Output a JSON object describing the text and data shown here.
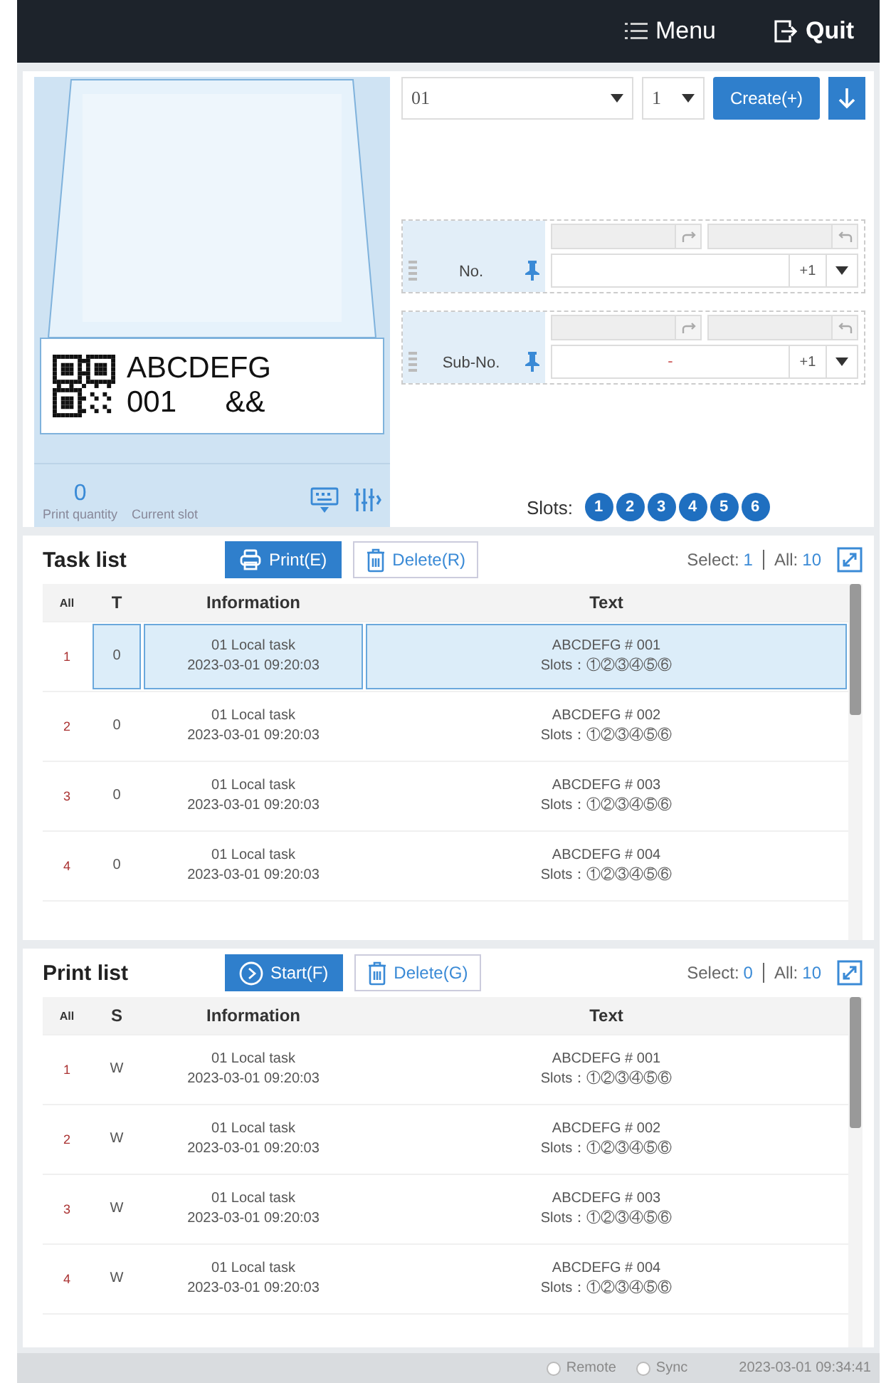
{
  "header": {
    "menu": "Menu",
    "quit": "Quit"
  },
  "preview": {
    "label_line1": "ABCDEFG",
    "label_line2": "001",
    "label_line3": "&&",
    "print_quantity": "0",
    "print_quantity_label": "Print quantity",
    "current_slot_label": "Current slot"
  },
  "task_setup": {
    "template": "01",
    "count": "1",
    "create_button": "Create(+)"
  },
  "counters": [
    {
      "label": "No.",
      "step": "+1"
    },
    {
      "label": "Sub-No.",
      "value": "-",
      "step": "+1"
    }
  ],
  "slots": {
    "label": "Slots:",
    "items": [
      {
        "label": "1",
        "active": true
      },
      {
        "label": "2",
        "active": true
      },
      {
        "label": "3",
        "active": true
      },
      {
        "label": "4",
        "active": true
      },
      {
        "label": "5",
        "active": true
      },
      {
        "label": "6",
        "active": true
      }
    ]
  },
  "lists": [
    {
      "title": "Task list",
      "primary_button": {
        "label": "Print(E)",
        "kind": "print"
      },
      "delete_button": "Delete(R)",
      "select_label": "Select:",
      "select_count": "1",
      "all_label": "All:",
      "all_count": "10",
      "columns": [
        "All",
        "T",
        "Information",
        "Text"
      ],
      "rows": [
        {
          "index": "1",
          "status": "0",
          "info_name": "01  Local task",
          "info_time": "2023-03-01  09:20:03",
          "text_content": "ABCDEFG #  001",
          "text_slots": "Slots：①②③④⑤⑥",
          "selected": true
        },
        {
          "index": "2",
          "status": "0",
          "info_name": "01  Local task",
          "info_time": "2023-03-01  09:20:03",
          "text_content": "ABCDEFG #  002",
          "text_slots": "Slots：①②③④⑤⑥",
          "selected": false
        },
        {
          "index": "3",
          "status": "0",
          "info_name": "01  Local task",
          "info_time": "2023-03-01  09:20:03",
          "text_content": "ABCDEFG #  003",
          "text_slots": "Slots：①②③④⑤⑥",
          "selected": false
        },
        {
          "index": "4",
          "status": "0",
          "info_name": "01  Local task",
          "info_time": "2023-03-01  09:20:03",
          "text_content": "ABCDEFG #  004",
          "text_slots": "Slots：①②③④⑤⑥",
          "selected": false
        }
      ]
    },
    {
      "title": "Print list",
      "primary_button": {
        "label": "Start(F)",
        "kind": "start"
      },
      "delete_button": "Delete(G)",
      "select_label": "Select:",
      "select_count": "0",
      "all_label": "All:",
      "all_count": "10",
      "columns": [
        "All",
        "S",
        "Information",
        "Text"
      ],
      "rows": [
        {
          "index": "1",
          "status": "W",
          "info_name": "01  Local task",
          "info_time": "2023-03-01  09:20:03",
          "text_content": "ABCDEFG #  001",
          "text_slots": "Slots：①②③④⑤⑥",
          "selected": false
        },
        {
          "index": "2",
          "status": "W",
          "info_name": "01  Local task",
          "info_time": "2023-03-01  09:20:03",
          "text_content": "ABCDEFG #  002",
          "text_slots": "Slots：①②③④⑤⑥",
          "selected": false
        },
        {
          "index": "3",
          "status": "W",
          "info_name": "01  Local task",
          "info_time": "2023-03-01  09:20:03",
          "text_content": "ABCDEFG #  003",
          "text_slots": "Slots：①②③④⑤⑥",
          "selected": false
        },
        {
          "index": "4",
          "status": "W",
          "info_name": "01  Local task",
          "info_time": "2023-03-01  09:20:03",
          "text_content": "ABCDEFG #  004",
          "text_slots": "Slots：①②③④⑤⑥",
          "selected": false
        }
      ]
    }
  ],
  "status_bar": {
    "options": [
      {
        "label": "Remote",
        "selected": false
      },
      {
        "label": "Sync",
        "selected": false
      }
    ],
    "datetime": "2023-03-01  09:34:41"
  }
}
